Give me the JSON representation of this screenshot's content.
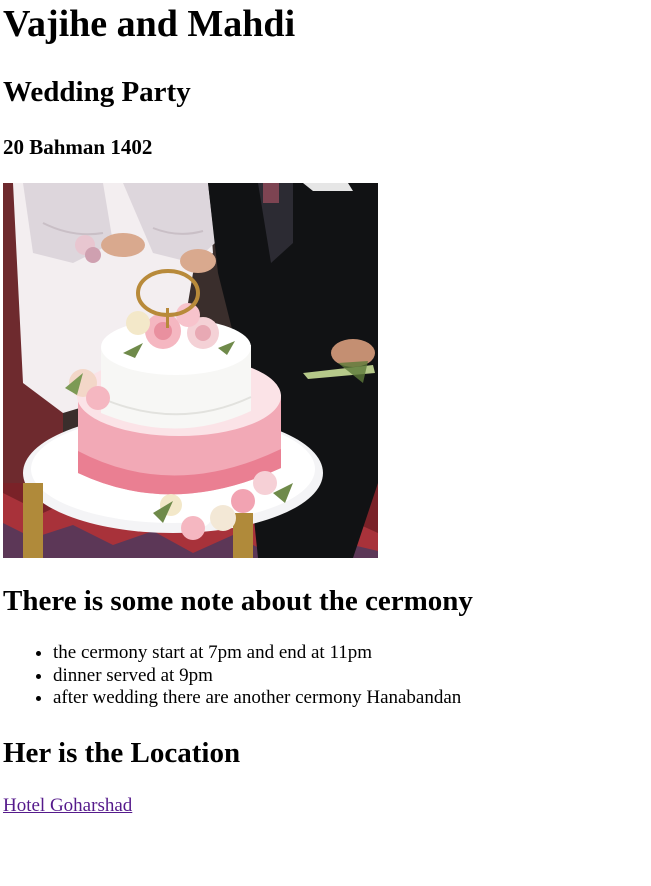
{
  "header": {
    "title": "Vajihe and Mahdi",
    "subtitle": "Wedding Party",
    "date": "20 Bahman 1402"
  },
  "photo": {
    "subject": "wedding-cake-photo"
  },
  "notes": {
    "heading": "There is some note about the cermony",
    "items": [
      "the cermony start at 7pm and end at 11pm",
      "dinner served at 9pm",
      "after wedding there are another cermony Hanabandan"
    ]
  },
  "location": {
    "heading": "Her is the Location",
    "link_text": "Hotel Goharshad"
  },
  "colors": {
    "text": "#000000",
    "link": "#551a8b"
  }
}
